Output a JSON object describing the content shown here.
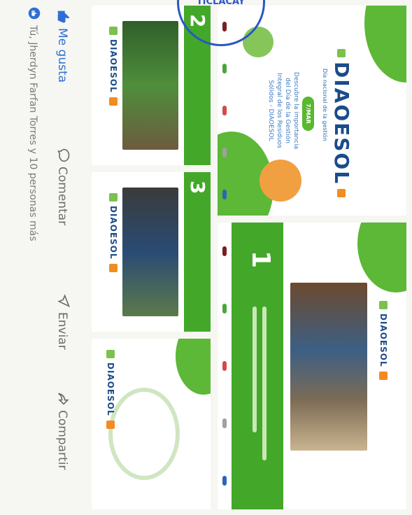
{
  "post": {
    "main_card": {
      "brand": "DIAOESOL",
      "tagline": "Día nacional de la gestión",
      "badge": "7/MAR",
      "text_lines": [
        "Descubre la importancia",
        "del Día de la Gestión",
        "Integral de los Residuos",
        "Sólidos - DIAOESOL"
      ]
    },
    "cards": [
      {
        "number": "1",
        "brand": "DIAOESOL"
      },
      {
        "number": "2",
        "brand": "DIAOESOL"
      },
      {
        "number": "3",
        "brand": "DIAOESOL"
      },
      {
        "number": "",
        "brand": "DIAOESOL"
      }
    ]
  },
  "actions": {
    "like": "Me gusta",
    "comment": "Comentar",
    "send": "Enviar",
    "share": "Compartir"
  },
  "reactions_text": "Tú, Jherdyn Farfan Torres y 10 personas más",
  "stamp_text": "TICLACAY",
  "colors": {
    "green": "#43a82a",
    "blue": "#2d6fd6",
    "orange": "#f28c22"
  }
}
